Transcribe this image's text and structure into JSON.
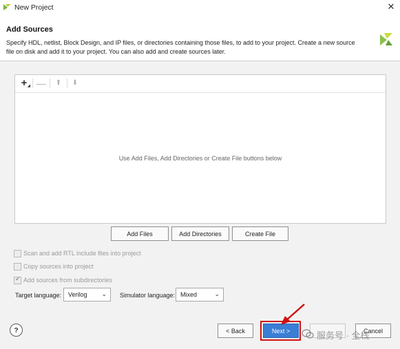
{
  "window": {
    "title": "New Project",
    "close_glyph": "✕"
  },
  "header": {
    "title": "Add Sources",
    "description": "Specify HDL, netlist, Block Design, and IP files, or directories containing those files, to add to your project. Create a new source file on disk and add it to your project. You can also add and create sources later."
  },
  "toolbar": {
    "add_glyph": "+",
    "remove_glyph": "—",
    "up_glyph": "⬆",
    "down_glyph": "⬇"
  },
  "panel": {
    "empty_message": "Use Add Files, Add Directories or Create File buttons below"
  },
  "buttons": {
    "add_files": "Add Files",
    "add_directories": "Add Directories",
    "create_file": "Create File",
    "back": "< Back",
    "next": "Next >",
    "finish": "",
    "cancel": "Cancel",
    "help": "?"
  },
  "options": [
    {
      "label": "Scan and add RTL include files into project",
      "checked": false
    },
    {
      "label": "Copy sources into project",
      "checked": false
    },
    {
      "label": "Add sources from subdirectories",
      "checked": true
    }
  ],
  "languages": {
    "target_label": "Target language:",
    "target_value": "Verilog",
    "simulator_label": "Simulator language:",
    "simulator_value": "Mixed"
  },
  "watermark": {
    "text": "服务号 · 全栈"
  },
  "colors": {
    "accent": "#3a7fd5",
    "highlight": "#d01010",
    "xilinx_green": "#7cb342"
  }
}
